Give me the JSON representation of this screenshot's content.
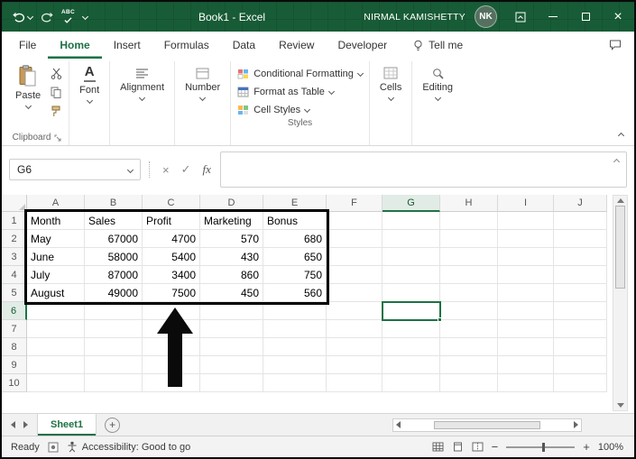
{
  "window": {
    "title": "Book1 - Excel",
    "user_name": "NIRMAL KAMISHETTY",
    "avatar_initials": "NK",
    "qat": {
      "spellcheck_label": "ABC"
    }
  },
  "ribbon": {
    "tabs": [
      {
        "label": "File"
      },
      {
        "label": "Home",
        "active": true
      },
      {
        "label": "Insert"
      },
      {
        "label": "Formulas"
      },
      {
        "label": "Data"
      },
      {
        "label": "Review"
      },
      {
        "label": "Developer"
      }
    ],
    "tell_me_label": "Tell me",
    "clipboard": {
      "paste_label": "Paste",
      "group_label": "Clipboard"
    },
    "font": {
      "label": "Font"
    },
    "alignment": {
      "label": "Alignment"
    },
    "number": {
      "label": "Number"
    },
    "styles": {
      "buttons": [
        {
          "label": "Conditional Formatting"
        },
        {
          "label": "Format as Table"
        },
        {
          "label": "Cell Styles"
        }
      ],
      "group_label": "Styles"
    },
    "cells": {
      "label": "Cells"
    },
    "editing": {
      "label": "Editing"
    }
  },
  "formula_bar": {
    "name_box": "G6",
    "cancel_glyph": "×",
    "enter_glyph": "✓",
    "fx_label": "fx",
    "formula_value": ""
  },
  "grid": {
    "columns": [
      "A",
      "B",
      "C",
      "D",
      "E",
      "F",
      "G",
      "H",
      "I",
      "J"
    ],
    "rows": [
      "1",
      "2",
      "3",
      "4",
      "5",
      "6",
      "7",
      "8",
      "9",
      "10"
    ],
    "selected_column": "G",
    "selected_row": "6",
    "selected_cell": "G6",
    "data": [
      [
        "Month",
        "Sales",
        "Profit",
        "Marketing",
        "Bonus"
      ],
      [
        "May",
        "67000",
        "4700",
        "570",
        "680"
      ],
      [
        "June",
        "58000",
        "5400",
        "430",
        "650"
      ],
      [
        "July",
        "87000",
        "3400",
        "860",
        "750"
      ],
      [
        "August",
        "49000",
        "7500",
        "450",
        "560"
      ]
    ]
  },
  "sheet_bar": {
    "tabs": [
      {
        "label": "Sheet1",
        "active": true
      }
    ]
  },
  "status_bar": {
    "ready_label": "Ready",
    "accessibility_label": "Accessibility: Good to go",
    "zoom_out_glyph": "−",
    "zoom_in_glyph": "+",
    "zoom_level": "100%"
  }
}
